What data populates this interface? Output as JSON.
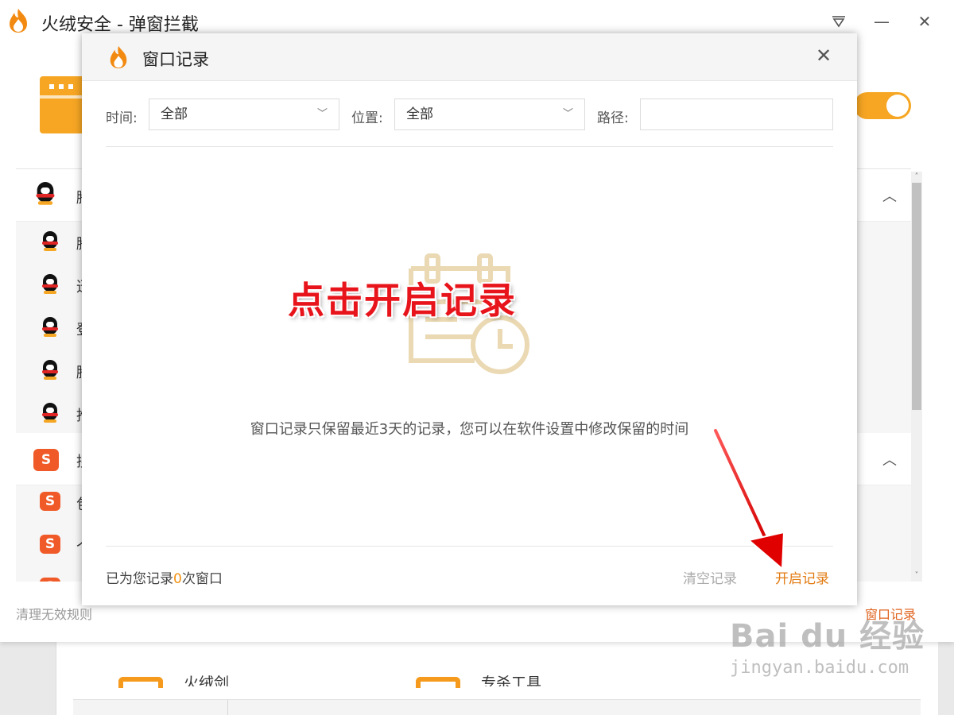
{
  "window": {
    "title": "火绒安全 - 弹窗拦截",
    "menu_icon": "triangle-down",
    "minimize_glyph": "—",
    "close_glyph": "✕"
  },
  "list": {
    "groups": [
      {
        "label": "腾",
        "expanded": true,
        "icon": "qq-penguin-icon",
        "children": [
          "腾",
          "迅",
          "登",
          "腾",
          "推"
        ]
      },
      {
        "label": "搜",
        "expanded": true,
        "icon": "sogou-icon",
        "children": [
          "包",
          "个",
          ""
        ]
      }
    ],
    "chevron_up": "︿"
  },
  "footer": {
    "left": "清理无效规则",
    "right": "窗口记录"
  },
  "background": {
    "item1": "火绒剑",
    "item2": "专杀工具"
  },
  "dialog": {
    "title": "窗口记录",
    "close_glyph": "✕",
    "filters": {
      "time_label": "时间:",
      "time_value": "全部",
      "position_label": "位置:",
      "position_value": "全部",
      "path_label": "路径:",
      "path_value": ""
    },
    "empty_message": "窗口记录只保留最近3天的记录，您可以在软件设置中修改保留的时间",
    "footer": {
      "recorded_prefix": "已为您记录",
      "recorded_count": "0",
      "recorded_suffix": "次窗口",
      "clear_button": "清空记录",
      "start_button": "开启记录"
    }
  },
  "annotation": {
    "text": "点击开启记录"
  },
  "watermark": {
    "main": "Bai du 经验",
    "sub": "jingyan.baidu.com"
  },
  "colors": {
    "accent_orange": "#f6a623",
    "link_orange": "#e27b12",
    "annotation_red": "#e8141b",
    "toggle_on": "#f6a623"
  }
}
